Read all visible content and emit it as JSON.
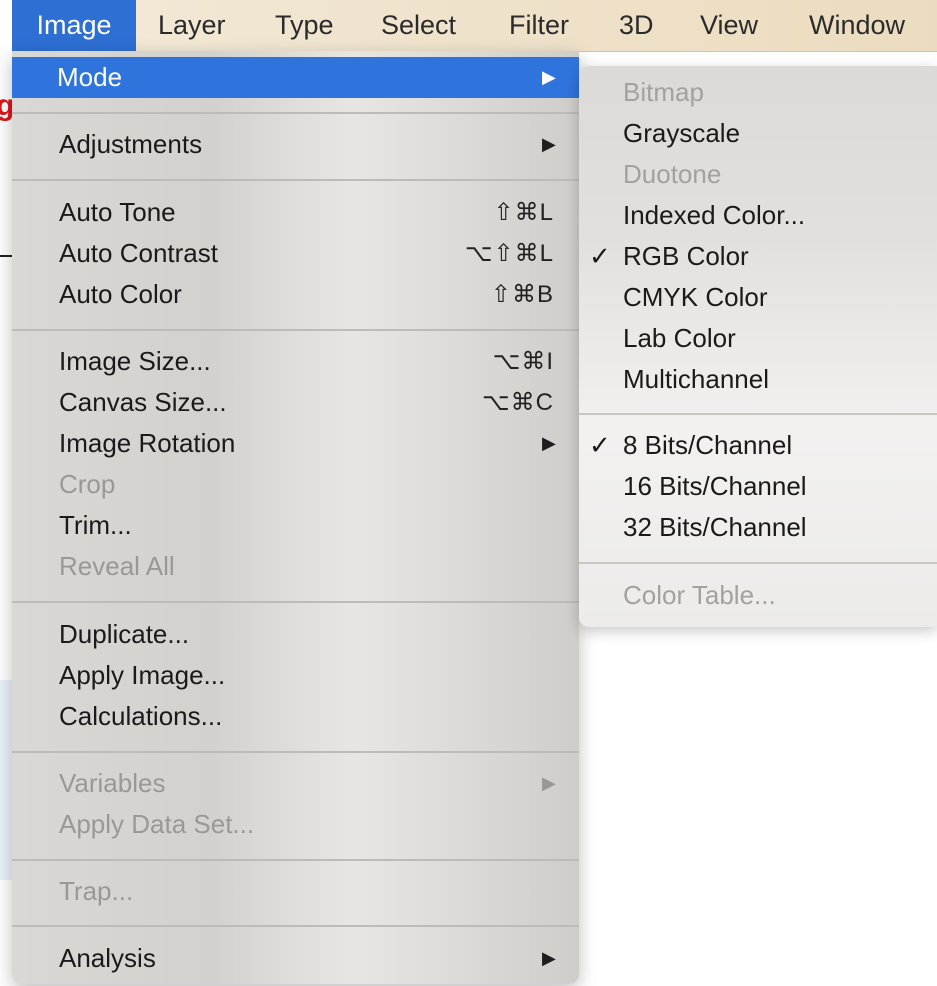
{
  "menubar": {
    "items": [
      "Image",
      "Layer",
      "Type",
      "Select",
      "Filter",
      "3D",
      "View",
      "Window"
    ]
  },
  "background_fragments": {
    "red_text": "g",
    "line_text": ""
  },
  "image_menu": {
    "items": [
      {
        "label": "Mode",
        "shortcut": "",
        "arrow": "▶"
      },
      {
        "label": "Adjustments",
        "shortcut": "",
        "arrow": "▶"
      },
      {
        "label": "Auto Tone",
        "shortcut": "⇧⌘L"
      },
      {
        "label": "Auto Contrast",
        "shortcut": "⌥⇧⌘L"
      },
      {
        "label": "Auto Color",
        "shortcut": "⇧⌘B"
      },
      {
        "label": "Image Size...",
        "shortcut": "⌥⌘I"
      },
      {
        "label": "Canvas Size...",
        "shortcut": "⌥⌘C"
      },
      {
        "label": "Image Rotation",
        "arrow": "▶"
      },
      {
        "label": "Crop"
      },
      {
        "label": "Trim..."
      },
      {
        "label": "Reveal All"
      },
      {
        "label": "Duplicate..."
      },
      {
        "label": "Apply Image..."
      },
      {
        "label": "Calculations..."
      },
      {
        "label": "Variables",
        "arrow": "▶"
      },
      {
        "label": "Apply Data Set..."
      },
      {
        "label": "Trap..."
      },
      {
        "label": "Analysis",
        "arrow": "▶"
      }
    ],
    "disabled": [
      "Crop",
      "Reveal All",
      "Variables",
      "Apply Data Set...",
      "Trap..."
    ],
    "highlighted": "Mode"
  },
  "mode_submenu": {
    "items": [
      {
        "label": "Bitmap",
        "check": ""
      },
      {
        "label": "Grayscale",
        "check": ""
      },
      {
        "label": "Duotone",
        "check": ""
      },
      {
        "label": "Indexed Color...",
        "check": ""
      },
      {
        "label": "RGB Color",
        "check": "✓"
      },
      {
        "label": "CMYK Color",
        "check": ""
      },
      {
        "label": "Lab Color",
        "check": ""
      },
      {
        "label": "Multichannel",
        "check": ""
      },
      {
        "label": "8 Bits/Channel",
        "check": "✓"
      },
      {
        "label": "16 Bits/Channel",
        "check": ""
      },
      {
        "label": "32 Bits/Channel",
        "check": ""
      },
      {
        "label": "Color Table...",
        "check": ""
      }
    ],
    "disabled": [
      "Bitmap",
      "Duotone",
      "Color Table..."
    ]
  },
  "colors": {
    "highlight": "#2f73dc",
    "menubar_active": "#2d6fd2",
    "disabled_text": "#9a9895"
  }
}
